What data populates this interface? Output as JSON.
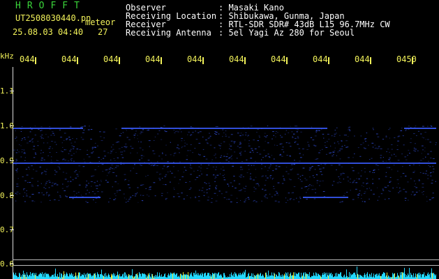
{
  "header": {
    "callsign": "HROFFT",
    "filename": "UT2508030440.pn",
    "mode": "meteor",
    "datetime": "25.08.03 04:40",
    "count": "27",
    "observer_label": "Observer",
    "observer_value": ": Masaki Kano",
    "location_label": "Receiving Location",
    "location_value": ": Shibukawa, Gunma, Japan",
    "receiver_label": "Receiver",
    "receiver_value": ": RTL-SDR SDR# 43dB L15 96.7MHz CW",
    "antenna_label": "Receiving Antenna",
    "antenna_value": ": 5el Yagi Az 280 for Seoul"
  },
  "axis": {
    "unit": "kHz",
    "y_ticks": [
      "1.1",
      "1.0",
      "0.9",
      "0.8",
      "0.7",
      "0.6"
    ],
    "x_ticks": [
      "044",
      "044",
      "044",
      "044",
      "044",
      "044",
      "044",
      "044",
      "044",
      "0450"
    ]
  },
  "colors": {
    "background": "#000000",
    "label": "#f2f25a",
    "title": "#3ad53a",
    "signal": "#3a5cff",
    "noise_floor": "#22d8ff"
  }
}
